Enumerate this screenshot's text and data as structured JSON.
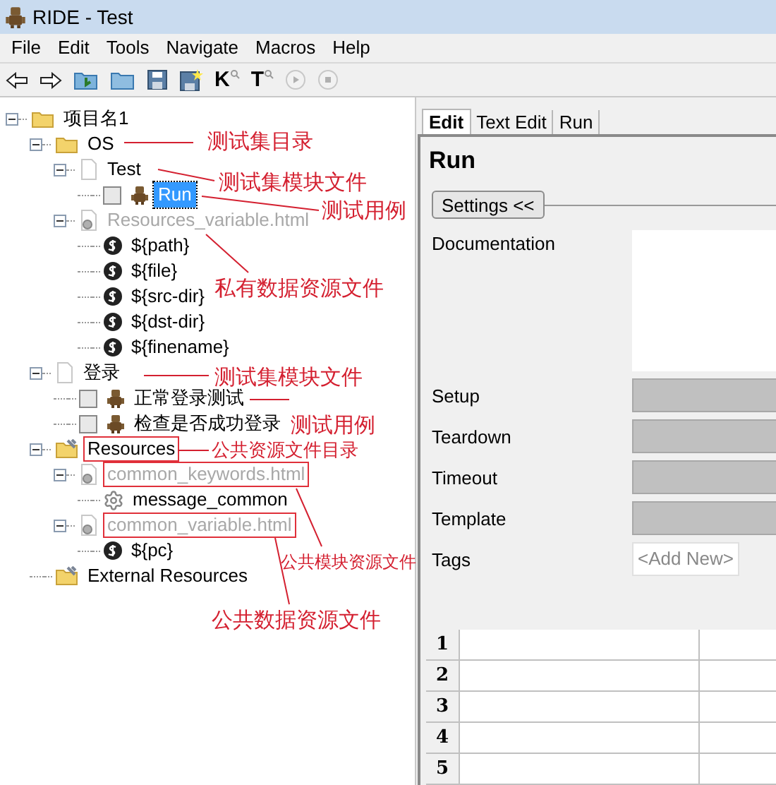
{
  "window": {
    "title": "RIDE - Test"
  },
  "menu": [
    "File",
    "Edit",
    "Tools",
    "Navigate",
    "Macros",
    "Help"
  ],
  "toolbar": [
    {
      "kind": "back"
    },
    {
      "kind": "forward"
    },
    {
      "kind": "open-suite"
    },
    {
      "kind": "open-folder"
    },
    {
      "kind": "save"
    },
    {
      "kind": "save-all"
    },
    {
      "kind": "search-keyword",
      "label": "K"
    },
    {
      "kind": "search-test",
      "label": "T"
    },
    {
      "kind": "run"
    },
    {
      "kind": "stop"
    }
  ],
  "tree": [
    {
      "kind": "folder",
      "label": "项目名1",
      "expanded": true,
      "children": [
        {
          "kind": "folder",
          "label": "OS",
          "expanded": true,
          "children": [
            {
              "kind": "suite",
              "label": "Test",
              "expanded": true,
              "children": [
                {
                  "kind": "test",
                  "label": "Run",
                  "checked": false,
                  "selected": true
                }
              ]
            },
            {
              "kind": "resource",
              "label": "Resources_variable.html",
              "expanded": true,
              "children": [
                {
                  "kind": "variable",
                  "label": "${path}"
                },
                {
                  "kind": "variable",
                  "label": "${file}"
                },
                {
                  "kind": "variable",
                  "label": "${src-dir}"
                },
                {
                  "kind": "variable",
                  "label": "${dst-dir}"
                },
                {
                  "kind": "variable",
                  "label": "${finename}"
                }
              ]
            }
          ]
        },
        {
          "kind": "suite",
          "label": "登录",
          "expanded": true,
          "children": [
            {
              "kind": "test",
              "label": "正常登录测试",
              "checked": false,
              "selected": false
            },
            {
              "kind": "test",
              "label": "检查是否成功登录",
              "checked": false,
              "selected": false
            }
          ]
        },
        {
          "kind": "resources",
          "label": "Resources",
          "expanded": true,
          "highlighted": true,
          "children": [
            {
              "kind": "resource",
              "label": "common_keywords.html",
              "expanded": true,
              "highlighted": true,
              "children": [
                {
                  "kind": "keyword",
                  "label": "message_common"
                }
              ]
            },
            {
              "kind": "resource",
              "label": "common_variable.html",
              "expanded": true,
              "highlighted": true,
              "children": [
                {
                  "kind": "variable",
                  "label": "${pc}"
                }
              ]
            }
          ]
        },
        {
          "kind": "resources",
          "label": "External Resources"
        }
      ]
    }
  ],
  "annotations": [
    "测试集目录",
    "测试集模块文件",
    "测试用例",
    "私有数据资源文件",
    "测试集模块文件",
    "测试用例",
    "公共资源文件目录",
    "公共模块资源文件",
    "公共数据资源文件"
  ],
  "tabs": [
    {
      "label": "Edit",
      "selected": true
    },
    {
      "label": "Text Edit",
      "selected": false
    },
    {
      "label": "Run",
      "selected": false
    }
  ],
  "editor": {
    "title": "Run",
    "settings_button": "Settings <<",
    "settings": [
      {
        "kind": "documentation",
        "label": "Documentation"
      },
      {
        "kind": "field",
        "label": "Setup"
      },
      {
        "kind": "field",
        "label": "Teardown"
      },
      {
        "kind": "field",
        "label": "Timeout"
      },
      {
        "kind": "field",
        "label": "Template"
      },
      {
        "kind": "tags",
        "label": "Tags",
        "value": "<Add New>"
      }
    ],
    "grid_rows": [
      "1",
      "2",
      "3",
      "4",
      "5"
    ]
  }
}
